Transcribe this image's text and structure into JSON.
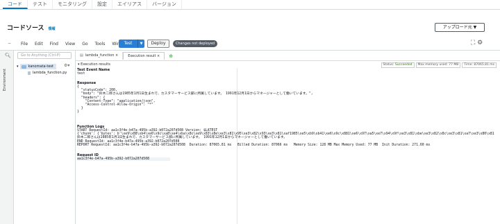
{
  "top_tabs": [
    "コード",
    "テスト",
    "モニタリング",
    "設定",
    "エイリアス",
    "バージョン"
  ],
  "code_source": {
    "title": "コードソース",
    "info": "情報",
    "upload_label": "アップロード元 ▼"
  },
  "toolbar": {
    "minus": "−",
    "menu": [
      "File",
      "Edit",
      "Find",
      "View",
      "Go",
      "Tools",
      "Window"
    ],
    "test_label": "Test",
    "test_dropdown": "▼",
    "deploy_label": "Deploy",
    "badge": "Changes not deployed",
    "right_icons": "⛶ ⚙"
  },
  "sidebar": {
    "search_placeholder": "Go to Anything (Ctrl-P)",
    "environment_label": "Environment",
    "folder": "kanomata-test",
    "file": "lambda_function.py"
  },
  "editor": {
    "tabs": [
      "lambda_function ×",
      "Execution result ×"
    ],
    "plus": "⊕"
  },
  "results": {
    "title": "▾ Execution results",
    "status_label": "Status:",
    "status_value": "Succeeded",
    "max_memory": "Max memory used: 77 MB",
    "time": "Time: 87065.81 ms",
    "test_event_name_h": "Test Event Name",
    "test_event_name": "test",
    "response_h": "Response",
    "response_lines": [
      "{",
      "  \"statusCode\": 200,",
      "  \"body\": \"鈴木二郎さんは1985年1月1日生まれで、カスタマーサービス部に所属しています。 1991年12月1日からマネージャーとして働いています。\",",
      "  \"headers\": {",
      "    \"Content-Type\": \"application/json\",",
      "    \"Access-Control-Allow-Origin\": \"*\"",
      "  }",
      "}"
    ],
    "logs_h": "Function Logs",
    "log_lines": [
      "START RequestId: aa1c3f4e-b47a-495b-a392-b072a207d508 Version: $LATEST",
      "{'chunk': {'bytes': b'\\xe9\\x88\\xb4\\xe6\\x9c\\xa8\\xe4\\xba\\x8c\\xe9\\x83\\x8e\\xe3\\x81\\x95\\xe3\\x82\\x93\\xe3\\x81\\xaf1985\\xe5\\xb9\\xb41\\xe6\\x9c\\x881\\xe6\\x97\\xa5\\xe7\\x94\\x9f\\xe3\\x81\\xbe\\xe3\\x82\\x8c\\xe3\\x81\\xa7\\xe3\\x80\\x81",
      "鈴木二郎さんは1985年1月1日生まれで、カスタマーサービス部に所属しています。 1991年12月1日からマネージャーとして働いています。",
      "END RequestId: aa1c3f4e-b47a-495b-a392-b072a207d508",
      "REPORT RequestId: aa1c3f4e-b47a-495b-a392-b072a207d508  Duration: 87065.81 ms   Billed Duration: 87066 ms   Memory Size: 128 MB Max Memory Used: 77 MB  Init Duration: 271.60 ms"
    ],
    "request_id_h": "Request ID",
    "request_id": "aa1c3f4e-b47a-495b-a392-b072a207d508"
  }
}
